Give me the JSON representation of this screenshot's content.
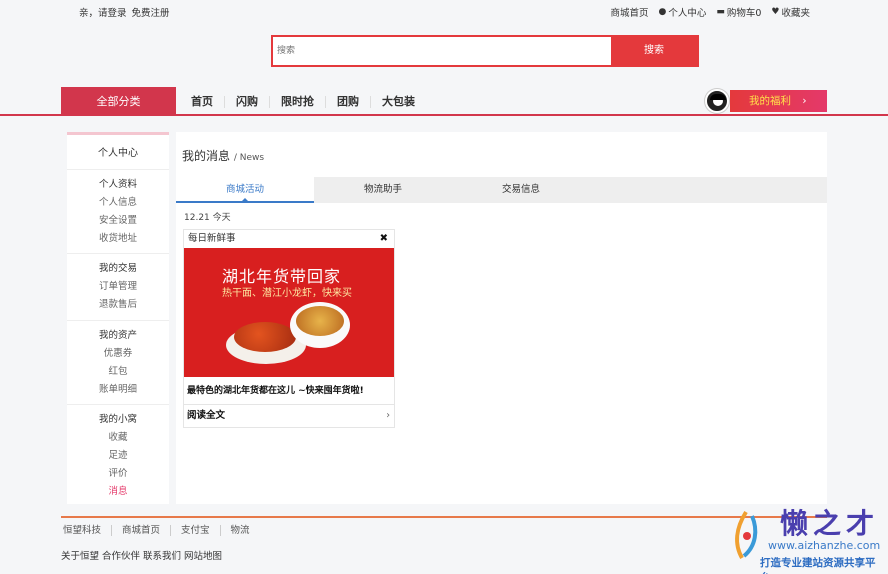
{
  "topbar": {
    "greeting": "亲，请登录",
    "register": "免费注册",
    "links": [
      {
        "icon": "",
        "label": "商城首页"
      },
      {
        "icon": "user-icon",
        "label": "个人中心"
      },
      {
        "icon": "cart-icon",
        "label": "购物车0"
      },
      {
        "icon": "heart-icon",
        "label": "收藏夹"
      }
    ]
  },
  "search": {
    "placeholder": "搜索",
    "button": "搜索"
  },
  "nav": {
    "all_categories": "全部分类",
    "links": [
      "首页",
      "闪购",
      "限时抢",
      "团购",
      "大包装"
    ],
    "welfare": "我的福利"
  },
  "sidebar": {
    "home": "个人中心",
    "sections": [
      {
        "title": "个人资料",
        "items": [
          "个人信息",
          "安全设置",
          "收货地址"
        ]
      },
      {
        "title": "我的交易",
        "items": [
          "订单管理",
          "退款售后"
        ]
      },
      {
        "title": "我的资产",
        "items": [
          "优惠券",
          "红包",
          "账单明细"
        ]
      },
      {
        "title": "我的小窝",
        "items": [
          "收藏",
          "足迹",
          "评价",
          "消息"
        ]
      }
    ],
    "active_item": "消息"
  },
  "main": {
    "title": "我的消息",
    "title_en": "News",
    "tabs": [
      "商城活动",
      "物流助手",
      "交易信息"
    ],
    "active_tab": 0,
    "date": "12.21 今天",
    "card": {
      "header": "每日新鲜事",
      "banner_title": "湖北年货带回家",
      "banner_subtitle": "热干面、潜江小龙虾，快来买",
      "title": "最特色的湖北年货都在这儿 ~快来囤年货啦!",
      "read_more": "阅读全文"
    }
  },
  "footer": {
    "links": [
      "恒望科技",
      "商城首页",
      "支付宝",
      "物流"
    ],
    "bottom": "关于恒望 合作伙伴 联系我们 网站地图"
  },
  "watermark": {
    "name": "懒之才",
    "url": "www.aizhanzhe.com",
    "slogan": "打造专业建站资源共享平台"
  },
  "colors": {
    "brand_red": "#e4393c",
    "nav_red": "#d2364c",
    "active_tab": "#3a7ac8"
  }
}
